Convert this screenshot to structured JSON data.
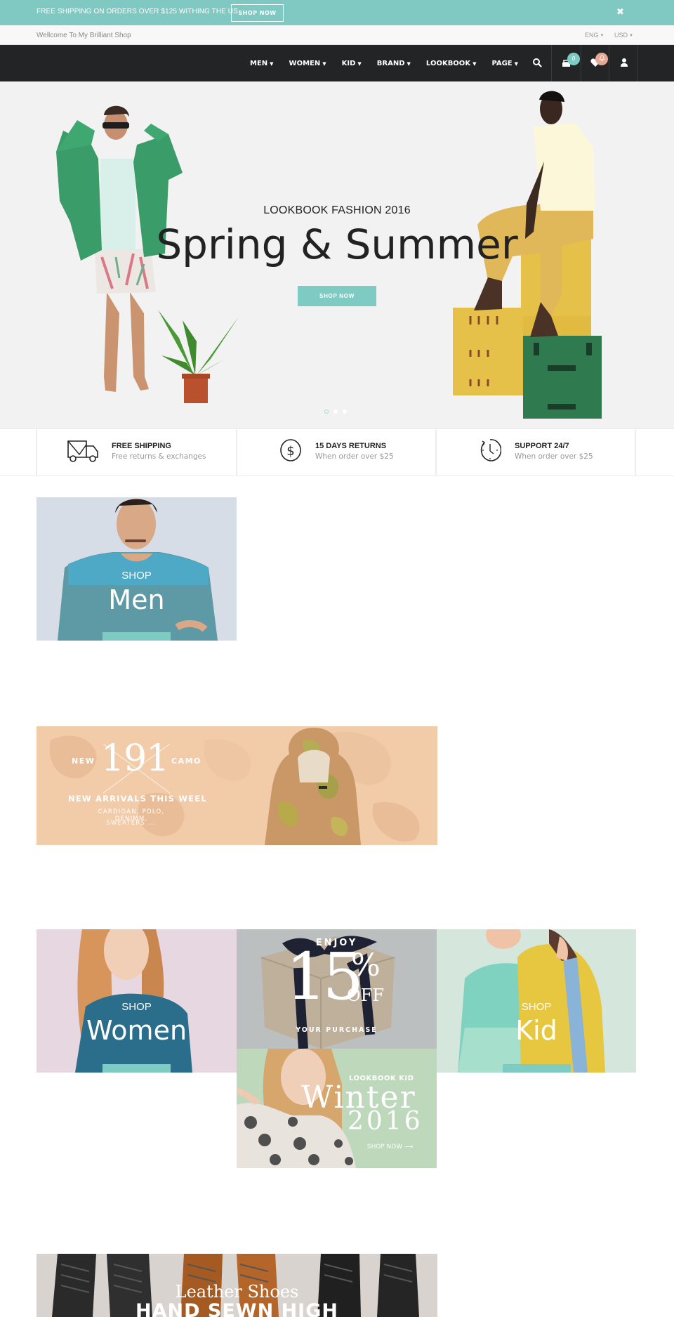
{
  "promo": {
    "text": "FREE SHIPPING ON ORDERS OVER $125 WITHING THE US",
    "button": "SHOP NOW",
    "close": "✖"
  },
  "topbar": {
    "welcome": "Wellcome To My Brilliant Shop",
    "language": "ENG",
    "currency": "USD"
  },
  "nav": {
    "items": [
      {
        "label": "MEN"
      },
      {
        "label": "WOMEN"
      },
      {
        "label": "KID"
      },
      {
        "label": "BRAND"
      },
      {
        "label": "LOOKBOOK"
      },
      {
        "label": "PAGE"
      }
    ],
    "cart_count": "0",
    "wishlist_badge": "♫",
    "colors": {
      "cart_badge": "#7ecbc3",
      "wishlist_badge": "#e8a994"
    }
  },
  "hero": {
    "subtitle": "LOOKBOOK FASHION 2016",
    "title": "Spring & Summer",
    "button": "SHOP NOW",
    "slides": 3,
    "active_slide": 1
  },
  "features": [
    {
      "icon": "truck-icon",
      "title": "FREE SHIPPING",
      "desc": "Free returns & exchanges"
    },
    {
      "icon": "dollar-icon",
      "title": "15 DAYS RETURNS",
      "desc": "When order over $25"
    },
    {
      "icon": "clock-icon",
      "title": "SUPPORT 24/7",
      "desc": "When order over $25"
    }
  ],
  "banners": {
    "men": {
      "shop": "SHOP",
      "title": "Men"
    },
    "camo": {
      "left": "NEW",
      "number": "191",
      "right": "CAMO",
      "headline": "NEW ARRIVALS THIS WEEL",
      "line1": "CARDIGAN, POLO, DENIMM,",
      "line2": "SWEATERS ..."
    },
    "women": {
      "shop": "SHOP",
      "title": "Women"
    },
    "sale": {
      "top": "ENJOY",
      "number": "15",
      "percent": "%",
      "off": "OFF",
      "bottom": "YOUR PURCHASE"
    },
    "kid": {
      "shop": "SHOP",
      "title": "Kid"
    },
    "lookbook_kid": {
      "label": "LOOKBOOK KID",
      "title": "Winter",
      "year": "2016",
      "link": "SHOP NOW ⟶"
    },
    "shoes": {
      "script": "Leather Shoes",
      "headline": "HAND SEWN HIGH"
    }
  },
  "colors": {
    "accent": "#7ecbc3",
    "promo_bg": "#80c9c2",
    "nav_bg": "#232425",
    "hero_bg": "#f2f2f2"
  }
}
